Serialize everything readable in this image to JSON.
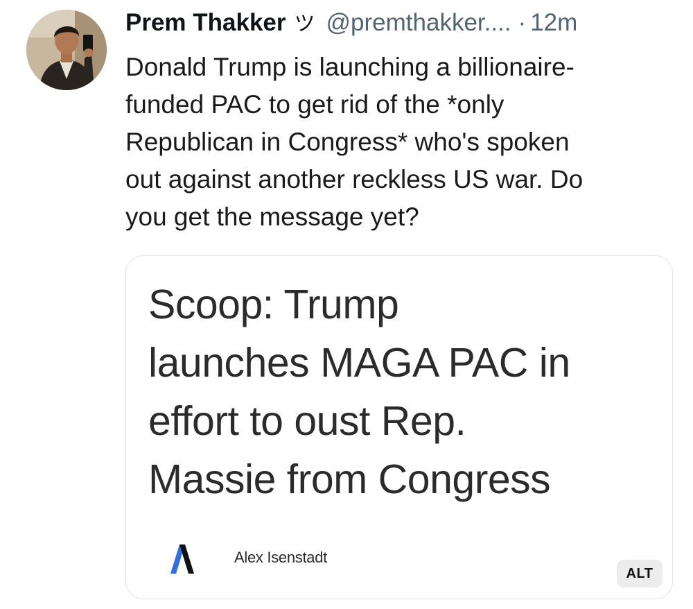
{
  "post": {
    "author": {
      "display_name": "Prem Thakker",
      "emoji": "ツ",
      "handle": "@premthakker....",
      "separator": "·",
      "timestamp": "12m"
    },
    "text": "Donald Trump is launching a billionaire-\nfunded PAC to get rid of the *only\nRepublican in Congress* who's spoken\nout against another reckless US war. Do\nyou get the message yet?",
    "media_card": {
      "headline": "Scoop: Trump\nlaunches MAGA PAC in\neffort to oust Rep.\nMassie from Congress",
      "byline": "Alex Isenstadt",
      "logo_icon": "axios-logo-icon",
      "alt_label": "ALT"
    }
  }
}
